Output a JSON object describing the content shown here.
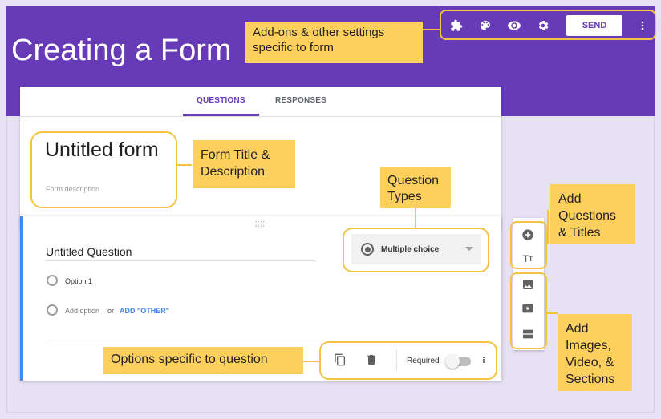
{
  "slide": {
    "title": "Creating a Form"
  },
  "toolbar": {
    "icons": [
      "puzzle-icon",
      "palette-icon",
      "eye-icon",
      "gear-icon",
      "more-vert-icon"
    ],
    "send_label": "SEND"
  },
  "tabs": [
    {
      "label": "QUESTIONS",
      "active": true
    },
    {
      "label": "RESPONSES",
      "active": false
    }
  ],
  "form": {
    "title": "Untitled form",
    "description_placeholder": "Form description"
  },
  "question": {
    "title": "Untitled Question",
    "option1": "Option 1",
    "add_option": "Add option",
    "or": "or",
    "add_other": "ADD \"OTHER\"",
    "type": "Multiple choice",
    "required_label": "Required",
    "required_on": false
  },
  "callouts": {
    "addons": "Add-ons & other settings specific to form",
    "title_desc": "Form Title & Description",
    "question_types": "Question Types",
    "add_questions": "Add Questions & Titles",
    "add_media": "Add Images, Video, & Sections",
    "options_specific": "Options specific to question"
  },
  "colors": {
    "brand": "#673ab7",
    "callout": "#fdd05e",
    "accent_blue": "#4285f4"
  }
}
